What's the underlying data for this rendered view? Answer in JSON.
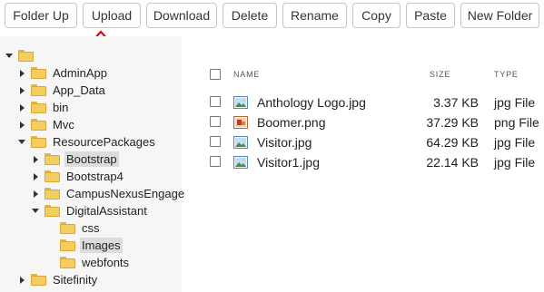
{
  "toolbar": {
    "buttons": [
      {
        "label": "Folder Up"
      },
      {
        "label": "Upload"
      },
      {
        "label": "Download"
      },
      {
        "label": "Delete"
      },
      {
        "label": "Rename"
      },
      {
        "label": "Copy"
      },
      {
        "label": "Paste"
      },
      {
        "label": "New Folder"
      }
    ],
    "annotation_color": "#e30613"
  },
  "tree": {
    "items": [
      {
        "label": "",
        "state": "expanded"
      },
      {
        "label": "AdminApp",
        "state": "collapsed"
      },
      {
        "label": "App_Data",
        "state": "collapsed"
      },
      {
        "label": "bin",
        "state": "collapsed"
      },
      {
        "label": "Mvc",
        "state": "collapsed"
      },
      {
        "label": "ResourcePackages",
        "state": "expanded"
      },
      {
        "label": "Bootstrap",
        "state": "collapsed",
        "selected": true
      },
      {
        "label": "Bootstrap4",
        "state": "collapsed"
      },
      {
        "label": "CampusNexusEngage",
        "state": "collapsed"
      },
      {
        "label": "DigitalAssistant",
        "state": "expanded"
      },
      {
        "label": "css",
        "state": "leaf"
      },
      {
        "label": "Images",
        "state": "leaf",
        "selected": true
      },
      {
        "label": "webfonts",
        "state": "leaf"
      },
      {
        "label": "Sitefinity",
        "state": "collapsed"
      }
    ]
  },
  "list": {
    "headers": {
      "name": "NAME",
      "size": "SIZE",
      "type": "TYPE"
    },
    "files": [
      {
        "name": "Anthology Logo.jpg",
        "size": "3.37 KB",
        "type": "jpg File",
        "icon": "image-jpg-icon"
      },
      {
        "name": "Boomer.png",
        "size": "37.29 KB",
        "type": "png File",
        "icon": "image-png-icon"
      },
      {
        "name": "Visitor.jpg",
        "size": "64.29 KB",
        "type": "jpg File",
        "icon": "image-jpg-icon"
      },
      {
        "name": "Visitor1.jpg",
        "size": "22.14 KB",
        "type": "jpg File",
        "icon": "image-jpg-icon"
      }
    ]
  }
}
